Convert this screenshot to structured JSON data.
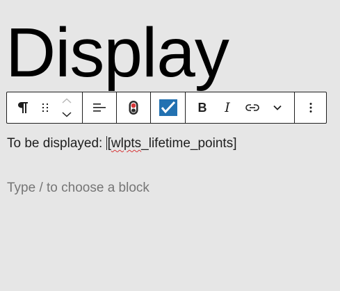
{
  "heading": {
    "text": "Display"
  },
  "toolbar": {
    "block_type": {
      "icon": "paragraph-icon"
    },
    "drag": {
      "icon": "drag-handle-icon"
    },
    "move": {
      "up_icon": "chevron-up-icon",
      "down_icon": "chevron-down-icon"
    },
    "align": {
      "icon": "align-left-icon"
    },
    "plugin_one": {
      "icon": "plugin-coin-icon"
    },
    "plugin_two": {
      "icon": "checkmark-square-icon",
      "color": "#2271b1"
    },
    "bold": {
      "label": "B"
    },
    "italic": {
      "label": "I"
    },
    "link": {
      "icon": "link-icon"
    },
    "more_formats": {
      "icon": "chevron-down-icon"
    },
    "options": {
      "icon": "more-vertical-icon"
    }
  },
  "paragraph": {
    "prefix": "To be displayed: ",
    "bracket_open": "[",
    "misspelled": "wlpts",
    "rest": "_lifetime_points]"
  },
  "placeholder": {
    "text": "Type / to choose a block"
  }
}
